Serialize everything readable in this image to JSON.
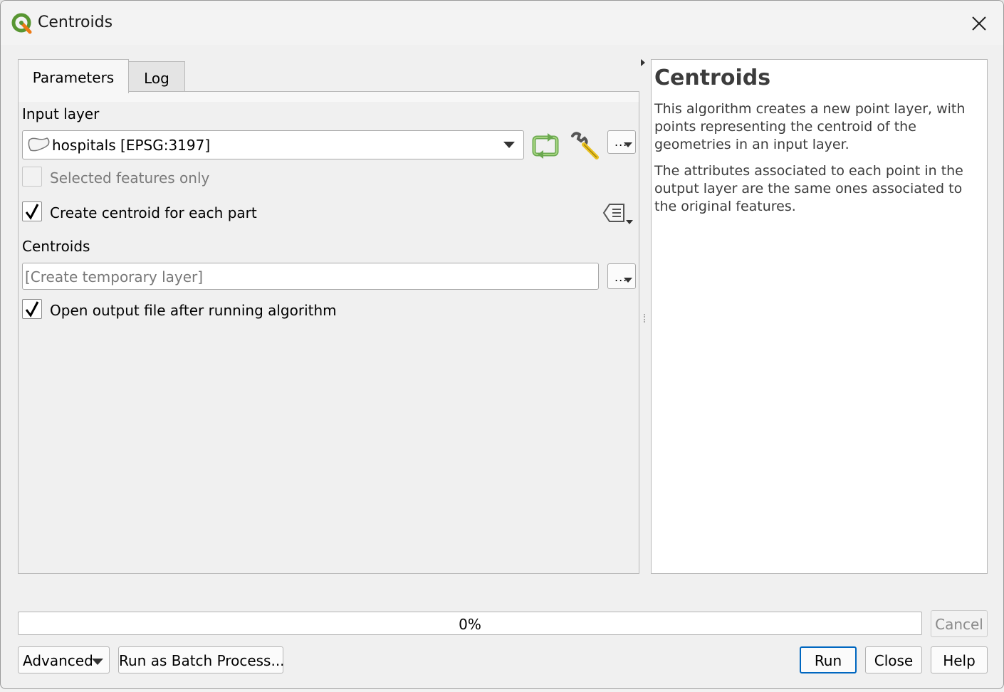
{
  "window": {
    "title": "Centroids"
  },
  "tabs": [
    {
      "label": "Parameters",
      "active": true
    },
    {
      "label": "Log",
      "active": false
    }
  ],
  "params": {
    "input_layer_label": "Input layer",
    "input_layer_value": "hospitals [EPSG:3197]",
    "selected_only_label": "Selected features only",
    "selected_only_checked": false,
    "each_part_label": "Create centroid for each part",
    "each_part_checked": true,
    "output_label": "Centroids",
    "output_placeholder": "[Create temporary layer]",
    "open_output_label": "Open output file after running algorithm",
    "open_output_checked": true,
    "more_button_label": "..."
  },
  "help": {
    "title": "Centroids",
    "paragraph1": "This algorithm creates a new point layer, with points representing the centroid of the geometries in an input layer.",
    "paragraph2": "The attributes associated to each point in the output layer are the same ones associated to the original features."
  },
  "progress": {
    "value": 0,
    "label": "0%"
  },
  "buttons": {
    "cancel": "Cancel",
    "advanced": "Advanced",
    "batch": "Run as Batch Process...",
    "run": "Run",
    "close": "Close",
    "help": "Help"
  },
  "icons": {
    "app": "qgis-logo-icon",
    "iterate": "iterate-icon",
    "settings": "wrench-icon",
    "polygon": "polygon-layer-icon",
    "data_defined": "data-defined-override-icon"
  },
  "colors": {
    "qgis_green": "#589632",
    "qgis_yellow": "#ee7913",
    "accent": "#0067c0",
    "progress_fill": "#06b025"
  }
}
